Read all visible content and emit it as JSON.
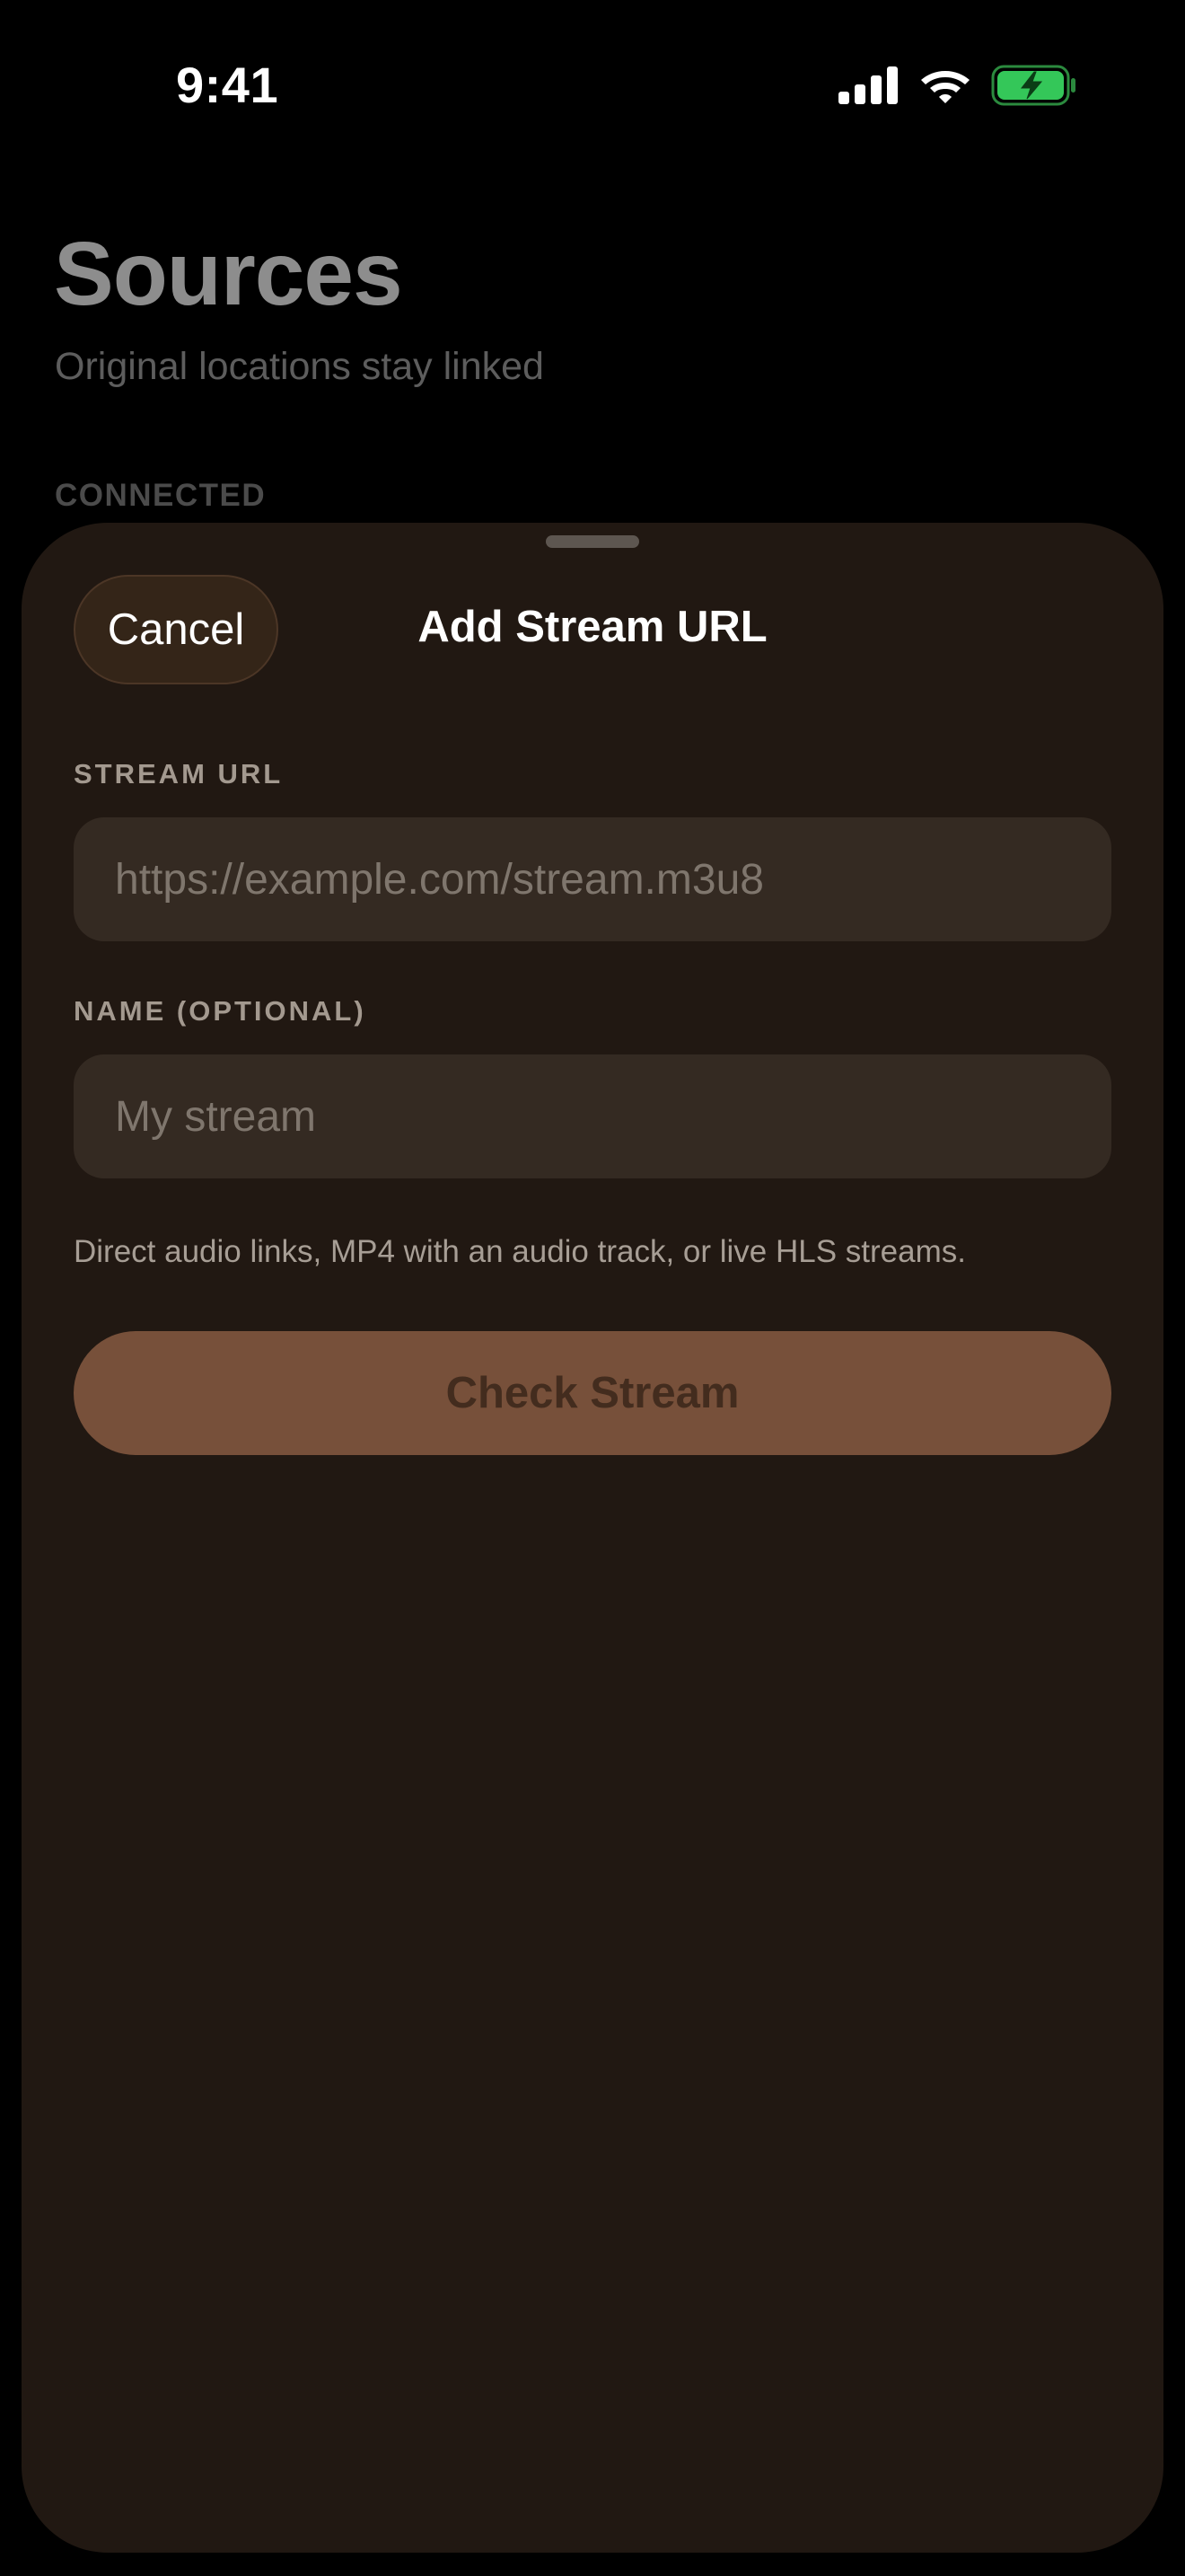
{
  "status_bar": {
    "time": "9:41",
    "icons": [
      "cellular-signal-icon",
      "wifi-icon",
      "battery-charging-icon"
    ],
    "battery_color": "#34c759"
  },
  "background_page": {
    "title": "Sources",
    "subtitle": "Original locations stay linked",
    "section_header": "CONNECTED"
  },
  "sheet": {
    "title": "Add Stream URL",
    "cancel_label": "Cancel",
    "stream_url": {
      "label": "STREAM URL",
      "value": "",
      "placeholder": "https://example.com/stream.m3u8"
    },
    "name": {
      "label": "NAME (OPTIONAL)",
      "value": "",
      "placeholder": "My stream"
    },
    "helper_text": "Direct audio links, MP4 with an audio track, or live HLS streams.",
    "check_button_label": "Check Stream",
    "check_button_disabled": true
  },
  "colors": {
    "sheet_background": "#211812",
    "field_background": "#342a22",
    "accent_button": "#77503a"
  }
}
